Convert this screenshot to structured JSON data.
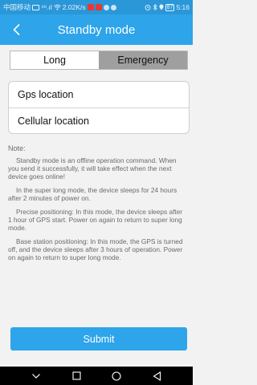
{
  "status_bar": {
    "carrier": "中国移动",
    "signal_text": "⁴⁶.ıl",
    "speed": "2.02K/s",
    "battery_pct": "87",
    "time": "5:16"
  },
  "app_bar": {
    "title": "Standby mode"
  },
  "mode_tabs": [
    {
      "label": "Long",
      "selected": false
    },
    {
      "label": "Emergency",
      "selected": true
    }
  ],
  "options": [
    {
      "label": "Gps location"
    },
    {
      "label": "Cellular location"
    }
  ],
  "note": {
    "title": "Note:",
    "paragraphs": [
      "Standby mode is an offline operation command. When you send it successfully, it will take effect when the next device goes online!",
      "In the super long mode, the device sleeps for 24 hours after 2 minutes of power on.",
      "Precise positioning: In this mode, the device sleeps after 1 hour of GPS start. Power on again to return to super long mode.",
      "Base station positioning: In this mode, the GPS is turned off, and the device sleeps after 3 hours of operation. Power on again to return to super long mode."
    ]
  },
  "submit": {
    "label": "Submit"
  },
  "colors": {
    "primary": "#2ea4ea",
    "status_bar": "#2a97d8",
    "selected_tab": "#9f9f9f"
  },
  "icons": {
    "back": "chevron-left-icon",
    "nav": [
      "chevron-down-icon",
      "recent-apps-icon",
      "home-icon",
      "back-triangle-icon"
    ]
  }
}
